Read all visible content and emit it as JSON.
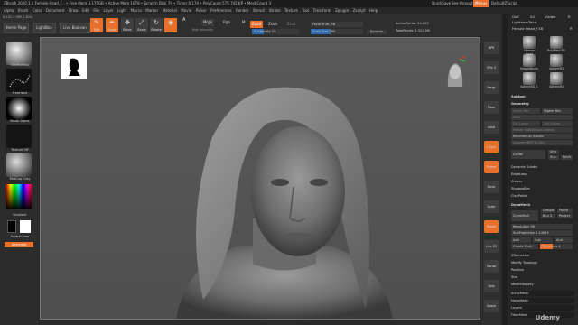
{
  "titlebar": {
    "text": "ZBrush 2020.1.4   Female Head_f...  • Free Mem 3.175GB • Active Mem 1078 • Scratch Disk 79 • Timer 0.174 • PolyCount 575.742 KP • MeshCount 3",
    "menus_btn": "Menus",
    "quicksave": "QuickSave",
    "seethrough": "See-through 0",
    "script": "DefaultZScript"
  },
  "menubar": {
    "items": [
      "Alpha",
      "Brush",
      "Color",
      "Document",
      "Draw",
      "Edit",
      "File",
      "Layer",
      "Light",
      "Macro",
      "Marker",
      "Material",
      "Movie",
      "Picker",
      "Preferences",
      "Render",
      "Stencil",
      "Stroke",
      "Texture",
      "Tool",
      "Transform",
      "Zplugin",
      "Zscript",
      "Help"
    ]
  },
  "coords": "0.152,1.965,1.824",
  "tabs": {
    "home": "Home Page",
    "lightbox": "LightBox",
    "live_boolean": "Live Boolean"
  },
  "tools": [
    {
      "label": "Edit",
      "glyph": "✎",
      "active": true
    },
    {
      "label": "Draw",
      "glyph": "✒",
      "active": true
    },
    {
      "label": "Move",
      "glyph": "✥",
      "active": false
    },
    {
      "label": "Scale",
      "glyph": "⤢",
      "active": false
    },
    {
      "label": "Rotate",
      "glyph": "↻",
      "active": false
    },
    {
      "label": "",
      "glyph": "◉",
      "active": true
    }
  ],
  "toolbar": {
    "a": "A",
    "mrgb": "Mrgb",
    "rgb": "Rgb",
    "m": "M",
    "rgb_intensity": "Rgb Intensity",
    "zadd": "Zadd",
    "zsub": "Zsub",
    "zcut": "Zcut",
    "z_intensity": "Z Intensity 25",
    "focal_shift": "Focal Shift -56",
    "draw_size": "Draw Size 380",
    "dynamic": "Dynamic",
    "active_points": "ActivePoints: 24,652",
    "total_points": "TotalPoints: 1.523 Mil"
  },
  "left_shelf": {
    "brush_label": "ClayBuildup",
    "stroke_label": "FreeHand",
    "alpha_label": "Brush Alpha",
    "texture_label": "Texture Off",
    "material_label": "MatCap Gray",
    "gradient_label": "Gradient",
    "switch_label": "SwitchColor",
    "alternate_label": "Alternate"
  },
  "right_shelf": {
    "buttons": [
      "BPR",
      "SPix 3",
      "Persp",
      "Floor",
      "Local",
      "L.Sym",
      "Frame",
      "Move",
      "Scale",
      "Rotate",
      "Line Fill",
      "Transp",
      "Solo",
      "Xpose"
    ]
  },
  "panel": {
    "header": {
      "goz": "GoZ",
      "all": "All",
      "visible": "Visible",
      "r": "R"
    },
    "lightbox_tools": "Lightbox▸Tools",
    "current_tool": "Female Head_f 48",
    "r2": "R",
    "thumbs": [
      "Female Head",
      "PolyMesh3D",
      "SimpleBrush",
      "Sphere3D",
      "Sphere3D_1",
      "Sphere3D"
    ],
    "sections": [
      "Subtool",
      "Geometry"
    ],
    "geometry": {
      "lower_res": "Lower Res",
      "higher_res": "Higher Res",
      "sdiv": "SDiv",
      "del_lower": "Del Lower",
      "del_higher": "Del Higher",
      "freeze": "Freeze SubDivision Levels",
      "reconstruct": "Reconstruct Subdiv",
      "convert_bpr": "Convert BPR To Geo",
      "divide": "Divide",
      "smt": "Smt",
      "suv": "Suv",
      "reuv": "ReUV",
      "dynamic_subdiv": "Dynamic Subdiv",
      "edgeloop": "EdgeLoop",
      "crease": "Crease",
      "shadowbox": "ShadowBox",
      "clayPolish": "ClayPolish"
    },
    "dynamesh": {
      "title": "DynaMesh",
      "dynamesh_btn": "DynaMesh",
      "groups": "Groups",
      "polish": "Polish",
      "blur": "Blur 2",
      "project": "Project",
      "resolution": "Resolution 96",
      "subprojection": "SubProjection 0.14693",
      "add": "Add",
      "sub": "Sub",
      "and": "And",
      "create_shell": "Create Shell",
      "thickness": "Thickness 4"
    },
    "more": [
      "ZRemesher",
      "Modify Topology",
      "Position",
      "Size",
      "MeshIntegrity"
    ],
    "lower": [
      "ArrayMesh",
      "NanoMesh",
      "Layers",
      "FiberMesh"
    ]
  },
  "watermark": "Udemy"
}
